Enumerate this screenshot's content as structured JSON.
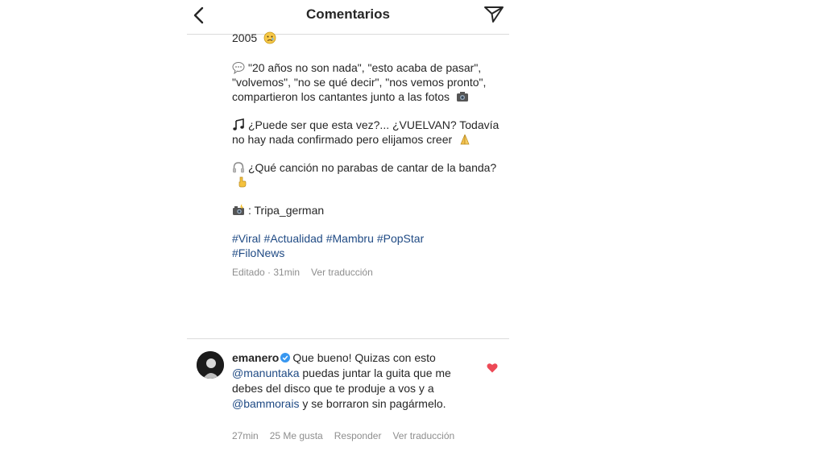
{
  "header": {
    "title": "Comentarios",
    "back_icon": "chevron-left-icon",
    "share_icon": "paper-plane-icon"
  },
  "caption": {
    "line_year": "2005",
    "para1": "\"20 años no son nada\", \"esto acaba de pasar\", \"volvemos\", \"no se qué decir\", \"nos vemos pronto\", compartieron los cantantes junto a las fotos",
    "para2": "¿Puede ser que esta vez?... ¿VUELVAN? Todavía no hay nada confirmado pero elijamos creer",
    "para3": "¿Qué canción no parabas de cantar de la banda?",
    "para4": ": Tripa_german",
    "hashtags": [
      "#Viral",
      "#Actualidad",
      "#Mambru",
      "#PopStar",
      "#FiloNews"
    ],
    "meta": {
      "edited": "Editado · 31min",
      "translate": "Ver traducción"
    }
  },
  "comment": {
    "username": "emanero",
    "text_start": "Que bueno! Quizas con esto",
    "mention1": "@manuntaka",
    "text_mid": "puedas juntar la guita que me debes del disco que te produje a vos y a",
    "mention2": "@bammorais",
    "text_end": "y se borraron sin pagármelo.",
    "time": "27min",
    "likes": "25 Me gusta",
    "reply": "Responder",
    "translate": "Ver traducción",
    "liked": true,
    "heart_color": "#ed4956"
  },
  "colors": {
    "link": "#1f4a84",
    "muted": "#8e8e8e",
    "verified": "#3897f0"
  }
}
